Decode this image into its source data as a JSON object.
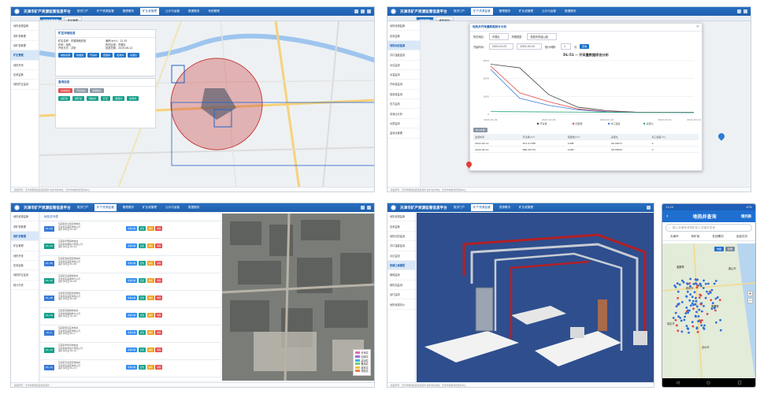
{
  "platform_title": "天津市矿产资源监管信息平台",
  "nav": [
    "首页门户",
    "矿产资源监管",
    "管理服务",
    "矿业权管理",
    "公示与运营",
    "数据服务",
    "系统管理"
  ],
  "nav_short": [
    "首页门户",
    "矿产资源监管",
    "资源概况",
    "矿业权管理",
    "公示与运营",
    "数据服务",
    "系统管理"
  ],
  "p1": {
    "tabs": [
      "矿产资源监管",
      "矿区管理"
    ],
    "sidebar": [
      "地热资源监管",
      "采矿权管理",
      "探矿权管理",
      "矿区管理",
      "地热开采",
      "压采监管",
      "地热矿区监测"
    ],
    "detail_title": "矿区详细信息",
    "detail_fields": [
      [
        "矿区名称：",
        "东丽湖地热田"
      ],
      [
        "面积(km²)：",
        "12.35"
      ],
      [
        "矿种：",
        "地热"
      ],
      [
        "所在区域：",
        "东丽区"
      ],
      [
        "开采方式：",
        "井采"
      ],
      [
        "批准日期：",
        "2019-06-12"
      ]
    ],
    "detail_tags": [
      "地热资源",
      "热储层",
      "开采井",
      "回灌井",
      "监测井",
      "采灌比"
    ],
    "search_title": "查询信息",
    "search_tags": [
      "采矿权",
      "探矿权",
      "地热井",
      "矿区",
      "回灌井",
      "监测井"
    ],
    "tab_btns": [
      "基本信息",
      "开采信息",
      "监测信息"
    ],
    "footer": "版权所有：天津市规划和自然资源局    技术支持单位：天津市地质调查研究中心"
  },
  "p2": {
    "tabs": [
      "压采监管",
      "地热监测"
    ],
    "sidebar": [
      "地热资源监管",
      "压采监管",
      "地热动态监测",
      "井口温度监测",
      "水位监测",
      "水温监测",
      "开采量监测",
      "回灌量监测",
      "压力监测",
      "采灌比分析",
      "水质监测",
      "监测点管理",
      "地热井管理",
      "地热井动态分析",
      "统计分析"
    ],
    "modal_title": "地热井开采量数据统计分析",
    "filter_label1": "所在地区：",
    "filter_val1": "东丽区",
    "filter_label2": "热储类型：",
    "filter_val2": "蓟县系雾迷山组",
    "date_label": "开始时间：",
    "date_start": "2022-01-01",
    "date_end": "2022-03-10",
    "interval_label": "统计间隔：",
    "interval_val": "1",
    "unit_label": "月",
    "query_btn": "查询",
    "chart_title": "DL-51 -- 开采量数据综合分析",
    "table_headers": [
      "监测时间",
      "开采量(m³)",
      "回灌量(m³)",
      "采灌比",
      "井口温度(℃)",
      "地热状态"
    ],
    "table_rows": [
      [
        "2022-02-11",
        "873.21788",
        "1098",
        "36.78071",
        "0"
      ],
      [
        "2022-02-12",
        "866.20779",
        "1098",
        "36.78052",
        "0"
      ]
    ],
    "ids_label": "DL-51井",
    "chart_data": {
      "type": "line",
      "title": "DL-51 -- 开采量数据综合分析",
      "categories": [
        "2022-01-01",
        "2022-01-10",
        "2022-01-20",
        "2022-02-01",
        "2022-02-10",
        "2022-02-20",
        "2022-03-01",
        "2022-03-10"
      ],
      "series": [
        {
          "name": "开采量",
          "values": [
            2800,
            2600,
            1100,
            400,
            200,
            120,
            110,
            110
          ]
        },
        {
          "name": "回灌量",
          "values": [
            2700,
            1200,
            700,
            300,
            150,
            110,
            105,
            100
          ]
        },
        {
          "name": "井口温度",
          "values": [
            2500,
            900,
            500,
            250,
            130,
            100,
            100,
            95
          ]
        },
        {
          "name": "采灌比",
          "values": [
            150,
            140,
            130,
            120,
            110,
            100,
            100,
            100
          ]
        }
      ],
      "ylim": [
        0,
        3000
      ]
    }
  },
  "p3": {
    "tabs": [
      "采矿权列表",
      "探矿权"
    ],
    "sidebar": [
      "地热资源监管",
      "采矿权管理",
      "探矿权管理",
      "矿区管理",
      "地热开采",
      "压采监管",
      "地热矿区监测",
      "统计分析"
    ],
    "list_title": "地热井列表",
    "rows": [
      [
        "DL-26",
        "东丽区新立街道地热井",
        "天津市东丽区地热公司",
        "采矿许可证 DL-26"
      ],
      [
        "DL-34",
        "东丽区华明镇地热井",
        "天津市华明热力有限公司",
        "采矿许可证 DL-34"
      ],
      [
        "DL-36",
        "东丽区金桥街道地热井",
        "天津市东丽区地热公司",
        "采矿许可证 DL-36"
      ],
      [
        "DL-40",
        "东丽区东丽湖地热井",
        "天津市东丽湖热力公司",
        "采矿许可证 DL-40"
      ],
      [
        "DL-48",
        "东丽区无瑕街道地热井",
        "天津市东丽区地热公司",
        "采矿许可证 DL-48"
      ],
      [
        "DL-19",
        "东丽区军粮城地热井",
        "天津市军粮城热力公司",
        "采矿许可证 DL-19"
      ],
      [
        "DL-1",
        "东丽区张贵庄地热井",
        "天津市东丽区地热公司",
        "采矿许可证 DL-1"
      ],
      [
        "DL-10",
        "东丽区丰年村地热井",
        "天津市丰年热力有限公司",
        "采矿许可证 DL-10"
      ],
      [
        "DL-11",
        "东丽区万新街道地热井",
        "天津市东丽区地热公司",
        "采矿许可证 DL-11"
      ]
    ],
    "row_actions": [
      "查看详情",
      "定位",
      "编辑",
      "删除"
    ],
    "legend": [
      "开采井",
      "回灌井",
      "监测井",
      "备用井",
      "废弃井",
      "规划井"
    ],
    "footer": "版权所有：天津市规划和自然资源局"
  },
  "p4": {
    "sidebar": [
      "地热资源监管",
      "压采监管",
      "地热动态监测",
      "井口温度监测",
      "水位监测",
      "热储三维模型",
      "管网监测",
      "换热站监测",
      "运行监测",
      "地热资源评价"
    ],
    "footer": "版权所有：天津市规划和自然资源局   技术支持单位：天津市地质调查研究中心"
  },
  "phone": {
    "time": "11:14",
    "battery": "47%",
    "title": "地热井查询",
    "right_action": "填列表",
    "search_placeholder": "输入井编号或采矿权人关键字查询",
    "filters": [
      "天津市",
      "有矿权",
      "在线情况",
      "全部井况"
    ],
    "map_btns": [
      "地图",
      "影像"
    ],
    "city_labels": [
      "北京市",
      "廊坊市",
      "天津市",
      "沧州市",
      "唐山市",
      "保定市"
    ]
  }
}
